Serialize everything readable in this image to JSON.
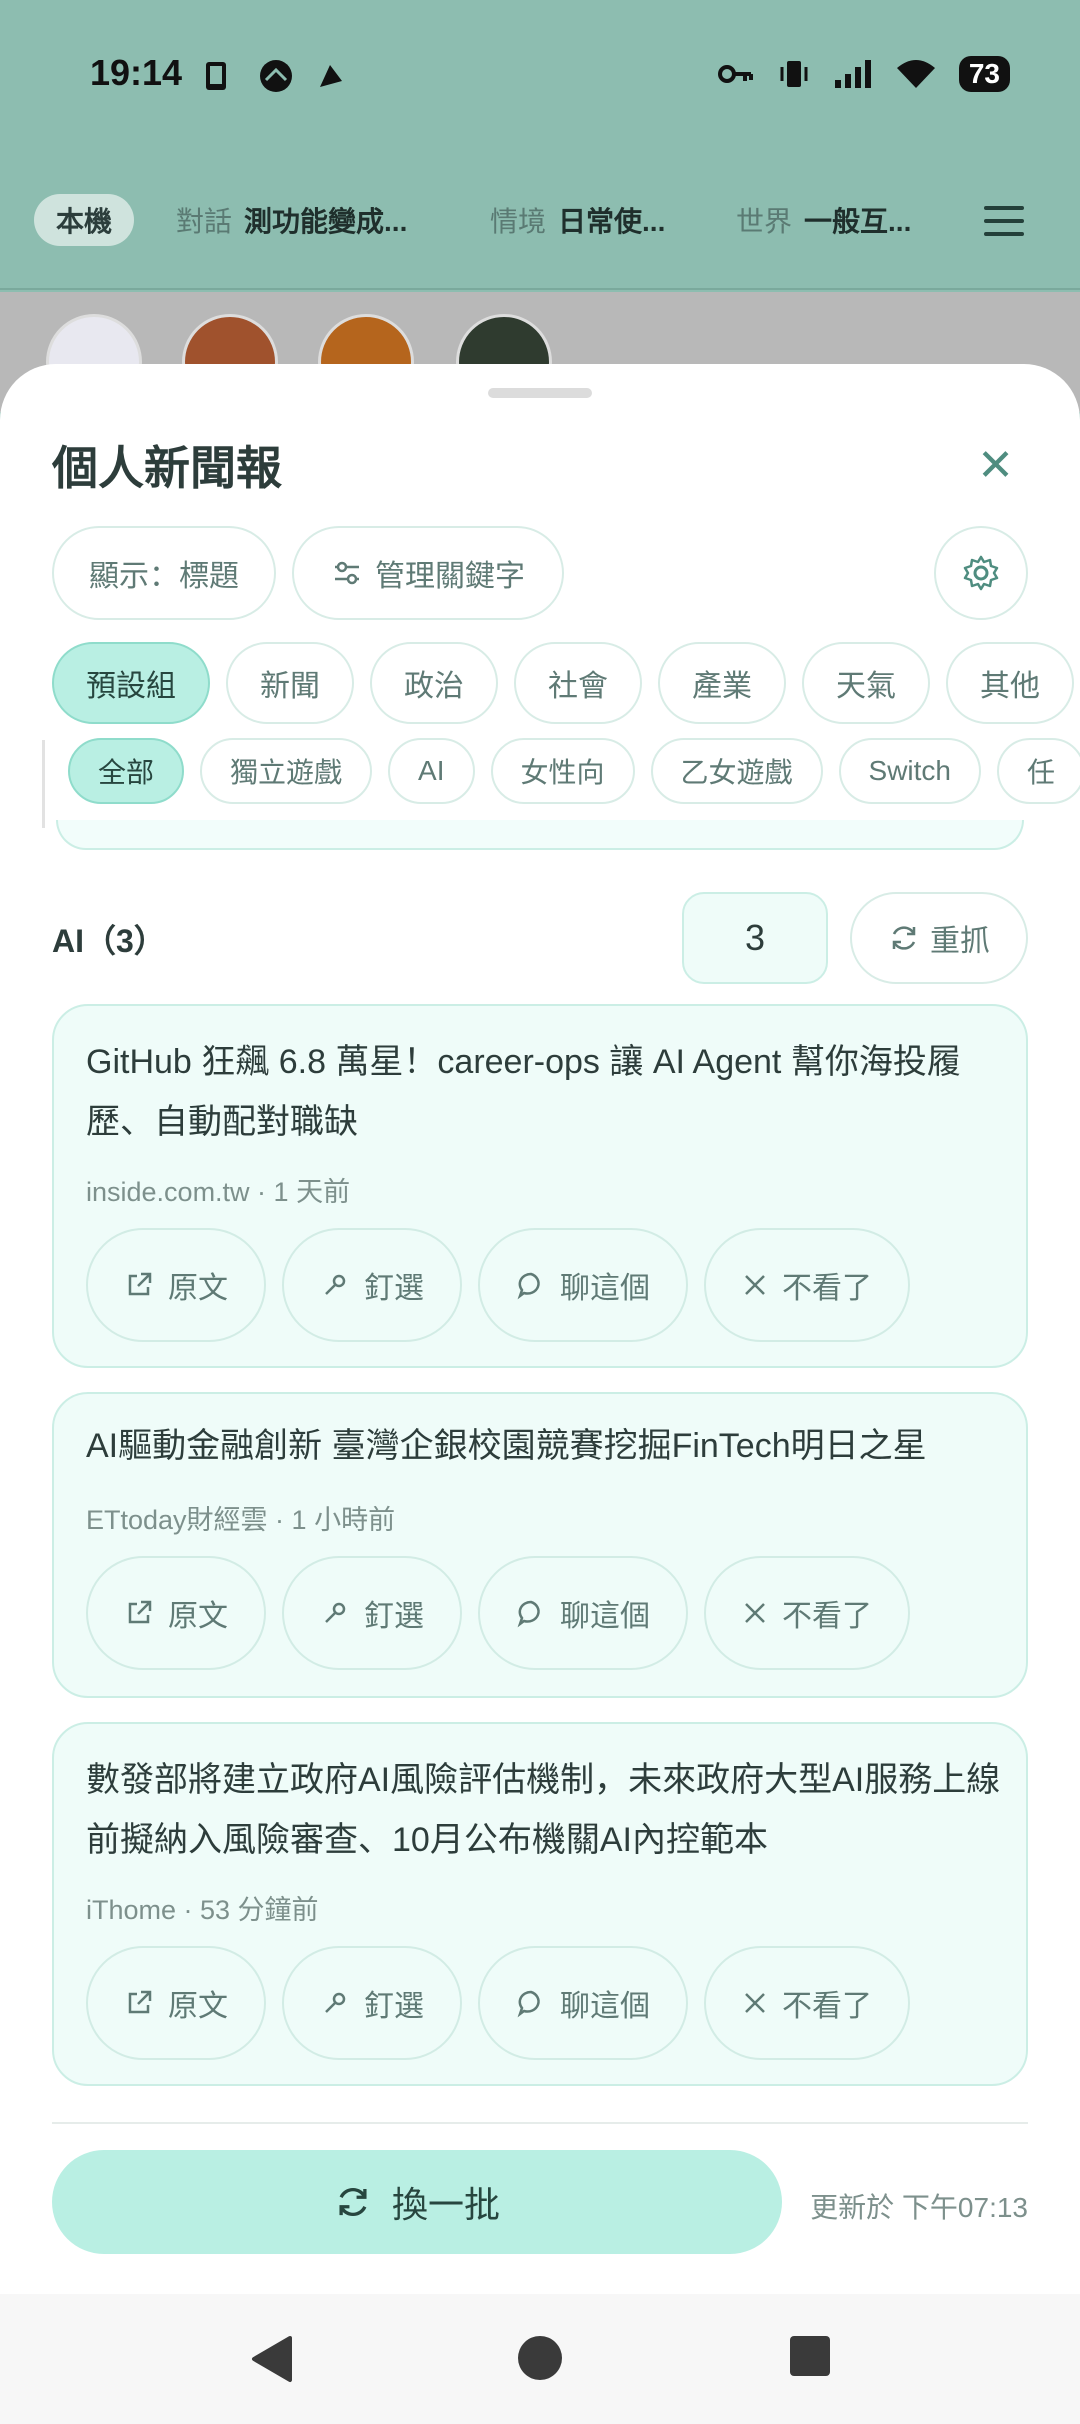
{
  "status": {
    "time": "19:14",
    "battery": "73"
  },
  "topnav": {
    "device_tab": "本機",
    "items": [
      {
        "key": "對話",
        "value": "測功能變成..."
      },
      {
        "key": "情境",
        "value": "日常使..."
      },
      {
        "key": "世界",
        "value": "一般互..."
      }
    ],
    "menu_icon": "hamburger-menu-icon"
  },
  "sheet": {
    "title": "個人新聞報",
    "display_button": "顯示：標題",
    "manage_keywords_button": "管理關鍵字",
    "category_chips": [
      "預設組",
      "新聞",
      "政治",
      "社會",
      "產業",
      "天氣",
      "其他"
    ],
    "keyword_chips": [
      "全部",
      "獨立遊戲",
      "AI",
      "女性向",
      "乙女遊戲",
      "Switch",
      "任"
    ],
    "section_label": "AI（3）",
    "count_value": "3",
    "refetch_button": "重抓",
    "articles": [
      {
        "title": "GitHub 狂飆 6.8 萬星！career-ops 讓 AI Agent 幫你海投履歷、自動配對職缺",
        "meta": "inside.com.tw · 1 天前"
      },
      {
        "title": "AI驅動金融創新 臺灣企銀校園競賽挖掘FinTech明日之星",
        "meta": "ETtoday財經雲 · 1 小時前"
      },
      {
        "title": "數發部將建立政府AI風險評估機制，未來政府大型AI服務上線前擬納入風險審查、10月公布機關AI內控範本",
        "meta": "iThome · 53 分鐘前"
      }
    ],
    "action_labels": {
      "source": "原文",
      "pin": "釘選",
      "chat": "聊這個",
      "hide": "不看了"
    },
    "swap_button": "換一批",
    "updated_text": "更新於 下午07:13"
  },
  "colors": {
    "accent": "#b9efe3",
    "header_bg": "#8dbdb0",
    "card_bg": "#effcf9"
  }
}
